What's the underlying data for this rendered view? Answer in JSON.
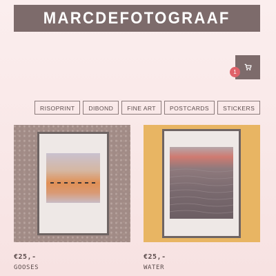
{
  "header": {
    "logo_text": "MARCDEFOTOGRAAF"
  },
  "cart": {
    "icon": "cart-icon",
    "count": "1"
  },
  "filters": [
    "RISOPRINT",
    "DIBOND",
    "FINE ART",
    "POSTCARDS",
    "STICKERS"
  ],
  "products": [
    {
      "price": "€25,-",
      "title": "GOOSES",
      "image": "framed-print-geese-sunset"
    },
    {
      "price": "€25,-",
      "title": "WATER",
      "image": "framed-print-water-waves"
    }
  ],
  "colors": {
    "header_bg": "#7d6b6b",
    "badge": "#e0626a",
    "background": "#f9e8e8"
  }
}
